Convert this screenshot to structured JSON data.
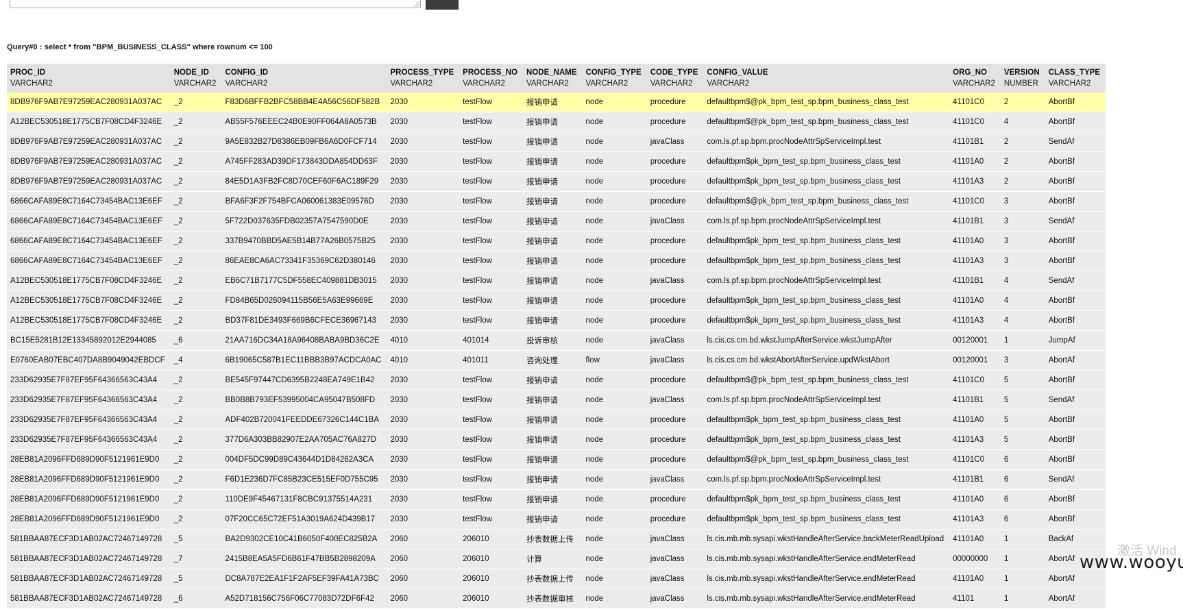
{
  "query_caption": "Query#0 : select * from \"BPM_BUSINESS_CLASS\" where rownum <= 100",
  "columns": [
    {
      "name": "PROC_ID",
      "type": "VARCHAR2"
    },
    {
      "name": "NODE_ID",
      "type": "VARCHAR2"
    },
    {
      "name": "CONFIG_ID",
      "type": "VARCHAR2"
    },
    {
      "name": "PROCESS_TYPE",
      "type": "VARCHAR2"
    },
    {
      "name": "PROCESS_NO",
      "type": "VARCHAR2"
    },
    {
      "name": "NODE_NAME",
      "type": "VARCHAR2"
    },
    {
      "name": "CONFIG_TYPE",
      "type": "VARCHAR2"
    },
    {
      "name": "CODE_TYPE",
      "type": "VARCHAR2"
    },
    {
      "name": "CONFIG_VALUE",
      "type": "VARCHAR2"
    },
    {
      "name": "ORG_NO",
      "type": "VARCHAR2"
    },
    {
      "name": "VERSION",
      "type": "NUMBER"
    },
    {
      "name": "CLASS_TYPE",
      "type": "VARCHAR2"
    }
  ],
  "rows": [
    [
      "8DB976F9AB7E97259EAC280931A037AC",
      "_2",
      "F83D6BFFB2BFC58BB4E4A56C56DF582B",
      "2030",
      "testFlow",
      "报销申请",
      "node",
      "procedure",
      "defaultbpm$@pk_bpm_test_sp.bpm_business_class_test",
      "41101C0",
      "2",
      "AbortBf"
    ],
    [
      "A12BEC530518E1775CB7F08CD4F3246E",
      "_2",
      "AB55F576EEEC24B0E90FF064A8A0573B",
      "2030",
      "testFlow",
      "报销申请",
      "node",
      "procedure",
      "defaultbpm$@pk_bpm_test_sp.bpm_business_class_test",
      "41101C0",
      "4",
      "AbortBf"
    ],
    [
      "8DB976F9AB7E97259EAC280931A037AC",
      "_2",
      "9A5E832B27D8386EB09FB6A6D0FCF714",
      "2030",
      "testFlow",
      "报销申请",
      "node",
      "javaClass",
      "com.ls.pf.sp.bpm.procNodeAttrSpServiceImpl.test",
      "41101B1",
      "2",
      "SendAf"
    ],
    [
      "8DB976F9AB7E97259EAC280931A037AC",
      "_2",
      "A745FF283AD39DF173843DDA854DD63F",
      "2030",
      "testFlow",
      "报销申请",
      "node",
      "procedure",
      "defaultbpm$pk_bpm_test_sp.bpm_business_class_test",
      "41101A0",
      "2",
      "AbortBf"
    ],
    [
      "8DB976F9AB7E97259EAC280931A037AC",
      "_2",
      "84E5D1A3FB2FC8D70CEF60F6AC189F29",
      "2030",
      "testFlow",
      "报销申请",
      "node",
      "procedure",
      "defaultbpm$pk_bpm_test_sp.bpm_business_class_test",
      "41101A3",
      "2",
      "AbortBf"
    ],
    [
      "6866CAFA89E8C7164C73454BAC13E6EF",
      "_2",
      "BFA6F3F2F754BFCA060061383E09576D",
      "2030",
      "testFlow",
      "报销申请",
      "node",
      "procedure",
      "defaultbpm$@pk_bpm_test_sp.bpm_business_class_test",
      "41101C0",
      "3",
      "AbortBf"
    ],
    [
      "6866CAFA89E8C7164C73454BAC13E6EF",
      "_2",
      "5F722D037635FDB02357A7547590D0E",
      "2030",
      "testFlow",
      "报销申请",
      "node",
      "javaClass",
      "com.ls.pf.sp.bpm.procNodeAttrSpServiceImpl.test",
      "41101B1",
      "3",
      "SendAf"
    ],
    [
      "6866CAFA89E8C7164C73454BAC13E6EF",
      "_2",
      "337B9470BBD5AE5B14B77A26B0575B25",
      "2030",
      "testFlow",
      "报销申请",
      "node",
      "procedure",
      "defaultbpm$pk_bpm_test_sp.bpm_business_class_test",
      "41101A0",
      "3",
      "AbortBf"
    ],
    [
      "6866CAFA89E8C7164C73454BAC13E6EF",
      "_2",
      "86EAE8CA6AC73341F35369C62D380146",
      "2030",
      "testFlow",
      "报销申请",
      "node",
      "procedure",
      "defaultbpm$pk_bpm_test_sp.bpm_business_class_test",
      "41101A3",
      "3",
      "AbortBf"
    ],
    [
      "A12BEC530518E1775CB7F08CD4F3246E",
      "_2",
      "EB6C71B7177C5DF558EC409881DB3015",
      "2030",
      "testFlow",
      "报销申请",
      "node",
      "javaClass",
      "com.ls.pf.sp.bpm.procNodeAttrSpServiceImpl.test",
      "41101B1",
      "4",
      "SendAf"
    ],
    [
      "A12BEC530518E1775CB7F08CD4F3246E",
      "_2",
      "FD84B65D026094115B56E5A63E99669E",
      "2030",
      "testFlow",
      "报销申请",
      "node",
      "procedure",
      "defaultbpm$pk_bpm_test_sp.bpm_business_class_test",
      "41101A0",
      "4",
      "AbortBf"
    ],
    [
      "A12BEC530518E1775CB7F08CD4F3246E",
      "_2",
      "BD37F81DE3493F669B6CFECE36967143",
      "2030",
      "testFlow",
      "报销申请",
      "node",
      "procedure",
      "defaultbpm$pk_bpm_test_sp.bpm_business_class_test",
      "41101A3",
      "4",
      "AbortBf"
    ],
    [
      "BC15E5281B12E13345892012E2944085",
      "_6",
      "21AA716DC34A18A96408BABA9BD36C2E",
      "4010",
      "401014",
      "投诉审核",
      "node",
      "javaClass",
      "ls.cis.cs.cm.bd.wkstJumpAfterService.wkstJumpAfter",
      "00120001",
      "1",
      "JumpAf"
    ],
    [
      "E0760EAB07EBC407DA8B9049042EBDCF",
      "_4",
      "6B19065C587B1EC11BBB3B97ACDCA0AC",
      "4010",
      "401011",
      "咨询处理",
      "flow",
      "javaClass",
      "ls.cis.cs.cm.bd.wkstAbortAfterService.updWkstAbort",
      "00120001",
      "3",
      "AbortAf"
    ],
    [
      "233D62935E7F87EF95F64366563C43A4",
      "_2",
      "BE545F97447CD6395B2248EA749E1B42",
      "2030",
      "testFlow",
      "报销申请",
      "node",
      "procedure",
      "defaultbpm$@pk_bpm_test_sp.bpm_business_class_test",
      "41101C0",
      "5",
      "AbortBf"
    ],
    [
      "233D62935E7F87EF95F64366563C43A4",
      "_2",
      "BB0B8B793EF53995004CA95047B508FD",
      "2030",
      "testFlow",
      "报销申请",
      "node",
      "javaClass",
      "com.ls.pf.sp.bpm.procNodeAttrSpServiceImpl.test",
      "41101B1",
      "5",
      "SendAf"
    ],
    [
      "233D62935E7F87EF95F64366563C43A4",
      "_2",
      "ADF402B720041FEEDDE67326C144C1BA",
      "2030",
      "testFlow",
      "报销申请",
      "node",
      "procedure",
      "defaultbpm$pk_bpm_test_sp.bpm_business_class_test",
      "41101A0",
      "5",
      "AbortBf"
    ],
    [
      "233D62935E7F87EF95F64366563C43A4",
      "_2",
      "377D6A303BB82907E2AA705AC76A827D",
      "2030",
      "testFlow",
      "报销申请",
      "node",
      "procedure",
      "defaultbpm$pk_bpm_test_sp.bpm_business_class_test",
      "41101A3",
      "5",
      "AbortBf"
    ],
    [
      "28EB81A2096FFD689D90F5121961E9D0",
      "_2",
      "004DF5DC99D89C43644D1D84262A3CA",
      "2030",
      "testFlow",
      "报销申请",
      "node",
      "procedure",
      "defaultbpm$@pk_bpm_test_sp.bpm_business_class_test",
      "41101C0",
      "6",
      "AbortBf"
    ],
    [
      "28EB81A2096FFD689D90F5121961E9D0",
      "_2",
      "F6D1E236D7FC85B23CE515EF0D755C95",
      "2030",
      "testFlow",
      "报销申请",
      "node",
      "javaClass",
      "com.ls.pf.sp.bpm.procNodeAttrSpServiceImpl.test",
      "41101B1",
      "6",
      "SendAf"
    ],
    [
      "28EB81A2096FFD689D90F5121961E9D0",
      "_2",
      "110DE9F45467131F8CBC91375514A231",
      "2030",
      "testFlow",
      "报销申请",
      "node",
      "procedure",
      "defaultbpm$pk_bpm_test_sp.bpm_business_class_test",
      "41101A0",
      "6",
      "AbortBf"
    ],
    [
      "28EB81A2096FFD689D90F5121961E9D0",
      "_2",
      "07F20CC65C72EF51A3019A624D439B17",
      "2030",
      "testFlow",
      "报销申请",
      "node",
      "procedure",
      "defaultbpm$pk_bpm_test_sp.bpm_business_class_test",
      "41101A3",
      "6",
      "AbortBf"
    ],
    [
      "581BBAA87ECF3D1AB02AC72467149728",
      "_5",
      "BA2D9302CE10C41B6050F400EC825B2A",
      "2060",
      "206010",
      "抄表数据上传",
      "node",
      "javaClass",
      "ls.cis.mb.mb.sysapi.wkstHandleAfterService.backMeterReadUpload",
      "41101A0",
      "1",
      "BackAf"
    ],
    [
      "581BBAA87ECF3D1AB02AC72467149728",
      "_7",
      "2415B8EA5A5FD6B61F47BB5B2898209A",
      "2060",
      "206010",
      "计算",
      "node",
      "javaClass",
      "ls.cis.mb.mb.sysapi.wkstHandleAfterService.endMeterRead",
      "00000000",
      "1",
      "AbortAf"
    ],
    [
      "581BBAA87ECF3D1AB02AC72467149728",
      "_5",
      "DC8A787E2EA1F1F2AF5EF39FA41A73BC",
      "2060",
      "206010",
      "抄表数据上传",
      "node",
      "javaClass",
      "ls.cis.mb.mb.sysapi.wkstHandleAfterService.endMeterRead",
      "41101A0",
      "1",
      "AbortAf"
    ],
    [
      "581BBAA87ECF3D1AB02AC72467149728",
      "_6",
      "A52D718156C756F06C77083D72DF6F42",
      "2060",
      "206010",
      "抄表数据审核",
      "node",
      "javaClass",
      "ls.cis.mb.mb.sysapi.wkstHandleAfterService.endMeterRead",
      "41101",
      "1",
      "AbortAf"
    ]
  ],
  "highlighted_row": 0,
  "watermark_activate": "激活 Wind",
  "watermark_site": "www.wooyun.org"
}
